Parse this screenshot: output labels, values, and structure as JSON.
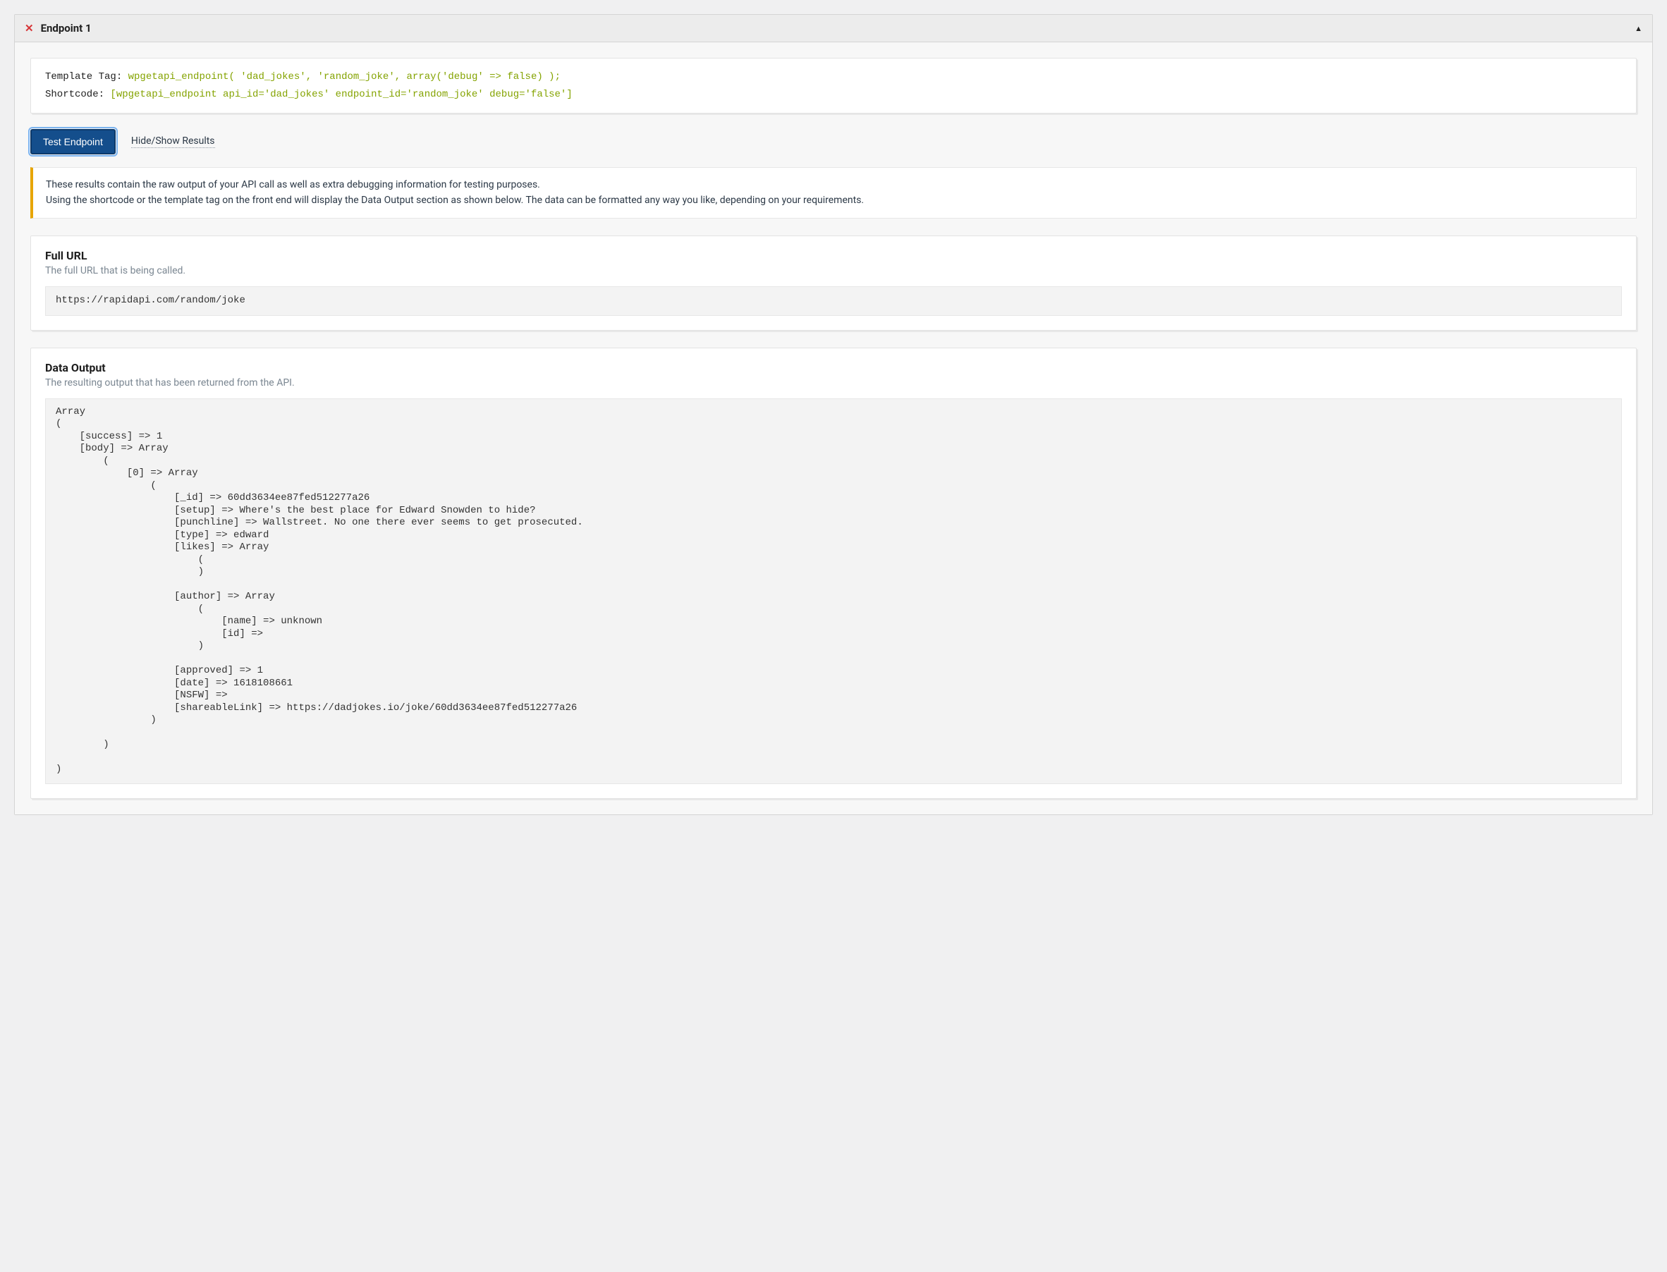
{
  "panel": {
    "title": "Endpoint 1"
  },
  "code": {
    "template_label": "Template Tag: ",
    "template_fn": "wpgetapi_endpoint( ",
    "template_arg1": "'dad_jokes'",
    "template_sep1": ", ",
    "template_arg2": "'random_joke'",
    "template_sep2": ", array(",
    "template_arg3": "'debug'",
    "template_sep3": " => false) );",
    "shortcode_label": "Shortcode: ",
    "shortcode_value": "[wpgetapi_endpoint api_id='dad_jokes' endpoint_id='random_joke' debug='false']"
  },
  "actions": {
    "test_button": "Test Endpoint",
    "toggle_link": "Hide/Show Results"
  },
  "notice": {
    "line1": "These results contain the raw output of your API call as well as extra debugging information for testing purposes.",
    "line2": "Using the shortcode or the template tag on the front end will display the Data Output section as shown below. The data can be formatted any way you like, depending on your requirements."
  },
  "full_url": {
    "heading": "Full URL",
    "sub": "The full URL that is being called.",
    "value": "https://rapidapi.com/random/joke"
  },
  "data_output": {
    "heading": "Data Output",
    "sub": "The resulting output that has been returned from the API.",
    "value": "Array\n(\n    [success] => 1\n    [body] => Array\n        (\n            [0] => Array\n                (\n                    [_id] => 60dd3634ee87fed512277a26\n                    [setup] => Where's the best place for Edward Snowden to hide?\n                    [punchline] => Wallstreet. No one there ever seems to get prosecuted.\n                    [type] => edward\n                    [likes] => Array\n                        (\n                        )\n\n                    [author] => Array\n                        (\n                            [name] => unknown\n                            [id] => \n                        )\n\n                    [approved] => 1\n                    [date] => 1618108661\n                    [NSFW] => \n                    [shareableLink] => https://dadjokes.io/joke/60dd3634ee87fed512277a26\n                )\n\n        )\n\n)"
  }
}
